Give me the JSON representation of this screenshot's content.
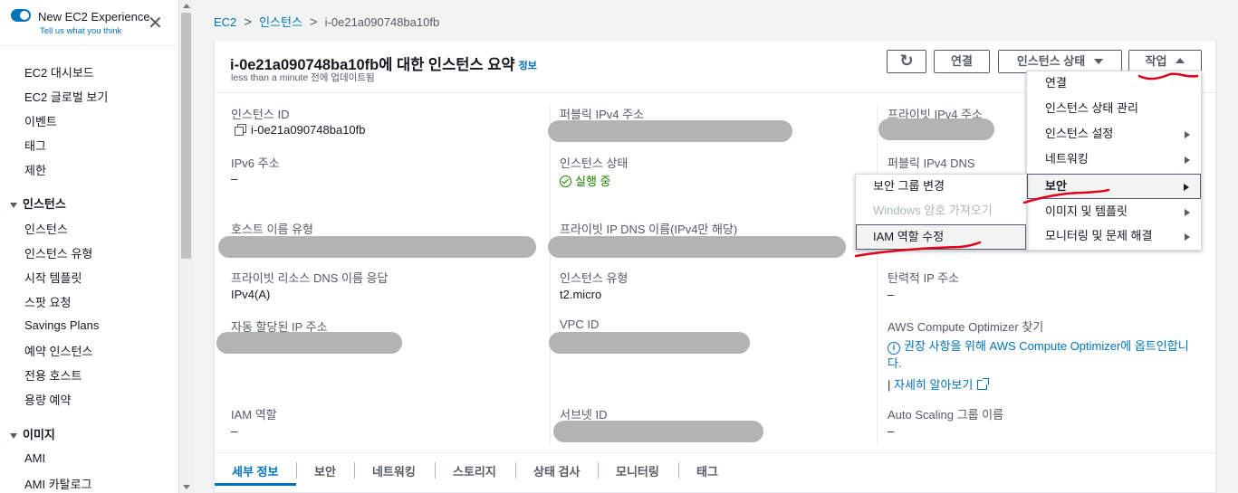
{
  "sidebar": {
    "experience_title": "New EC2 Experience",
    "experience_sub": "Tell us what you think",
    "close_glyph": "✕",
    "top_items": [
      "EC2 대시보드",
      "EC2 글로벌 보기",
      "이벤트",
      "태그",
      "제한"
    ],
    "instances_section": "인스턴스",
    "instances_items": [
      "인스턴스",
      "인스턴스 유형",
      "시작 템플릿",
      "스팟 요청",
      "Savings Plans",
      "예약 인스턴스",
      "전용 호스트",
      "용량 예약"
    ],
    "images_section": "이미지",
    "images_items": [
      "AMI",
      "AMI 카탈로그"
    ]
  },
  "breadcrumb": {
    "root": "EC2",
    "parent": "인스턴스",
    "current": "i-0e21a090748ba10fb",
    "separator": ">"
  },
  "summary": {
    "title": "i-0e21a090748ba10fb에 대한 인스턴스 요약",
    "info_link": "정보",
    "updated": "less than a minute 전에 업데이트됨"
  },
  "toolbar": {
    "refresh_glyph": "↻",
    "connect": "연결",
    "instance_state": "인스턴스 상태",
    "actions": "작업"
  },
  "fields": {
    "instance_id_label": "인스턴스 ID",
    "instance_id_value": "i-0e21a090748ba10fb",
    "public_ipv4_label": "퍼블릭 IPv4 주소",
    "private_ipv4_label": "프라이빗 IPv4 주소",
    "ipv6_label": "IPv6 주소",
    "ipv6_value": "–",
    "instance_state_label": "인스턴스 상태",
    "instance_state_value": "실행 중",
    "public_dns_label": "퍼블릭 IPv4 DNS",
    "hostname_type_label": "호스트 이름 유형",
    "private_dns_label": "프라이빗 IP DNS 이름(IPv4만 해당)",
    "private_resource_dns_label": "프라이빗 리소스 DNS 이름 응답",
    "private_resource_dns_value": "IPv4(A)",
    "instance_type_label": "인스턴스 유형",
    "instance_type_value": "t2.micro",
    "elastic_ip_label": "탄력적 IP 주소",
    "elastic_ip_value": "–",
    "auto_ip_label": "자동 할당된 IP 주소",
    "vpc_id_label": "VPC ID",
    "optimizer_label": "AWS Compute Optimizer 찾기",
    "optimizer_line1": "권장 사항을 위해 AWS Compute Optimizer에 옵트인합니",
    "optimizer_line2": "다.",
    "learn_more": "자세히 알아보기",
    "iam_role_label": "IAM 역할",
    "iam_role_value": "–",
    "subnet_id_label": "서브넷 ID",
    "asg_label": "Auto Scaling 그룹 이름",
    "asg_value": "–"
  },
  "tabs": [
    "세부 정보",
    "보안",
    "네트워킹",
    "스토리지",
    "상태 검사",
    "모니터링",
    "태그"
  ],
  "actions_menu": {
    "items": [
      "연결",
      "인스턴스 상태 관리",
      "인스턴스 설정",
      "네트워킹",
      "보안",
      "이미지 및 템플릿",
      "모니터링 및 문제 해결"
    ],
    "active_item": "보안"
  },
  "security_submenu": {
    "items": [
      "보안 그룹 변경",
      "Windows 암호 가져오기",
      "IAM 역할 수정"
    ],
    "disabled_item": "Windows 암호 가져오기",
    "highlighted_item": "IAM 역할 수정"
  },
  "colors": {
    "link": "#0073bb",
    "running": "#1d8102",
    "redaction": "#b3b3b3",
    "annotation": "#e0001b"
  }
}
